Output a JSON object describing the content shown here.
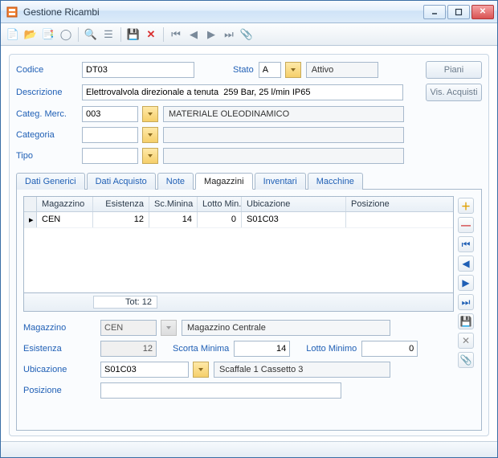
{
  "window": {
    "title": "Gestione Ricambi"
  },
  "toolbar": {},
  "buttons": {
    "piani": "Piani",
    "vis_acquisti": "Vis. Acquisti"
  },
  "header": {
    "codice_label": "Codice",
    "codice_value": "DT03",
    "stato_label": "Stato",
    "stato_code": "A",
    "stato_desc": "Attivo",
    "descrizione_label": "Descrizione",
    "descrizione_value": "Elettrovalvola direzionale a tenuta  259 Bar, 25 l/min IP65",
    "categ_merc_label": "Categ. Merc.",
    "categ_merc_code": "003",
    "categ_merc_desc": "MATERIALE OLEODINAMICO",
    "categoria_label": "Categoria",
    "categoria_code": "",
    "categoria_desc": "",
    "tipo_label": "Tipo",
    "tipo_code": "",
    "tipo_desc": ""
  },
  "tabs": {
    "dati_generici": "Dati Generici",
    "dati_acquisto": "Dati Acquisto",
    "note": "Note",
    "magazzini": "Magazzini",
    "inventari": "Inventari",
    "macchine": "Macchine"
  },
  "grid": {
    "columns": {
      "magazzino": "Magazzino",
      "esistenza": "Esistenza",
      "sc_minina": "Sc.Minina",
      "lotto_min": "Lotto Min.",
      "ubicazione": "Ubicazione",
      "posizione": "Posizione"
    },
    "rows": [
      {
        "magazzino": "CEN",
        "esistenza": "12",
        "sc_minina": "14",
        "lotto_min": "0",
        "ubicazione": "S01C03",
        "posizione": ""
      }
    ],
    "total_label": "Tot: 12"
  },
  "detail": {
    "magazzino_label": "Magazzino",
    "magazzino_code": "CEN",
    "magazzino_desc": "Magazzino Centrale",
    "esistenza_label": "Esistenza",
    "esistenza_value": "12",
    "scorta_min_label": "Scorta Minima",
    "scorta_min_value": "14",
    "lotto_min_label": "Lotto Minimo",
    "lotto_min_value": "0",
    "ubicazione_label": "Ubicazione",
    "ubicazione_code": "S01C03",
    "ubicazione_desc": "Scaffale 1 Cassetto 3",
    "posizione_label": "Posizione",
    "posizione_value": ""
  }
}
